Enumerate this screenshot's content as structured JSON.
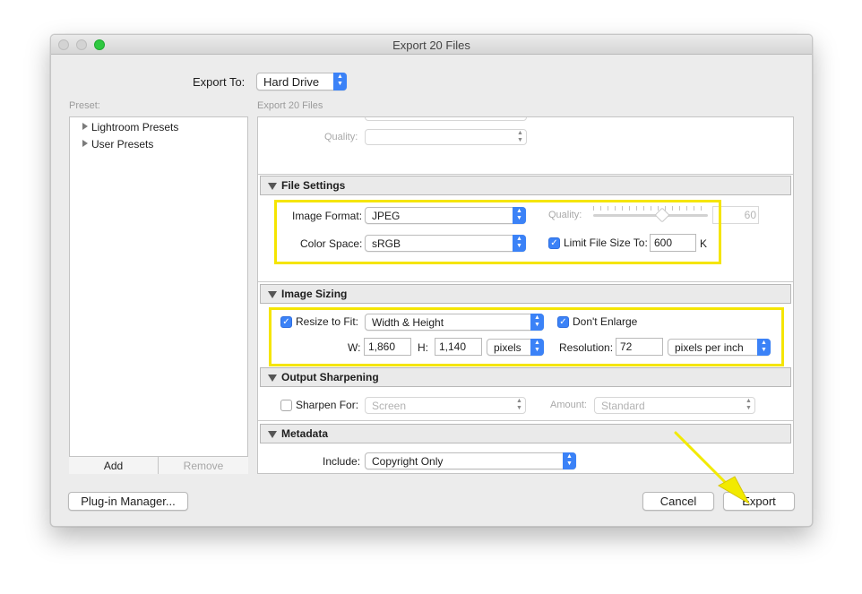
{
  "window": {
    "title": "Export 20 Files"
  },
  "export_to": {
    "label": "Export To:",
    "value": "Hard Drive"
  },
  "preset": {
    "label": "Preset:",
    "items": [
      "Lightroom Presets",
      "User Presets"
    ],
    "add_label": "Add",
    "remove_label": "Remove"
  },
  "settings_header": "Export 20 Files",
  "top_partial": {
    "quality_label": "Quality:"
  },
  "file_settings": {
    "title": "File Settings",
    "image_format_label": "Image Format:",
    "image_format_value": "JPEG",
    "quality_label": "Quality:",
    "quality_value": "60",
    "quality_level": 60,
    "color_space_label": "Color Space:",
    "color_space_value": "sRGB",
    "limit_label": "Limit File Size To:",
    "limit_checked": true,
    "limit_value": "600",
    "limit_unit": "K"
  },
  "image_sizing": {
    "title": "Image Sizing",
    "resize_label": "Resize to Fit:",
    "resize_checked": true,
    "resize_value": "Width & Height",
    "dont_enlarge_label": "Don't Enlarge",
    "dont_enlarge_checked": true,
    "w_label": "W:",
    "w_value": "1,860",
    "h_label": "H:",
    "h_value": "1,140",
    "unit_value": "pixels",
    "resolution_label": "Resolution:",
    "resolution_value": "72",
    "resolution_unit": "pixels per inch"
  },
  "output_sharpening": {
    "title": "Output Sharpening",
    "sharpen_label": "Sharpen For:",
    "sharpen_checked": false,
    "sharpen_value": "Screen",
    "amount_label": "Amount:",
    "amount_value": "Standard"
  },
  "metadata": {
    "title": "Metadata",
    "include_label": "Include:",
    "include_value": "Copyright Only"
  },
  "footer": {
    "plugin_label": "Plug-in Manager...",
    "cancel_label": "Cancel",
    "export_label": "Export"
  },
  "colors": {
    "accent": "#3b82f7",
    "highlight": "#f5e500",
    "arrow": "#f2ea00"
  }
}
